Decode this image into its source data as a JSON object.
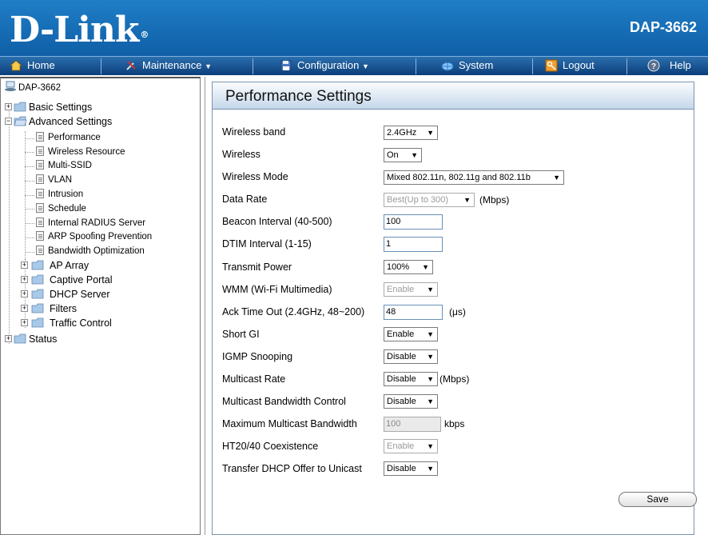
{
  "header": {
    "brand": "D-Link",
    "reg": "®",
    "model": "DAP-3662"
  },
  "menu": {
    "home": "Home",
    "maintenance": "Maintenance",
    "configuration": "Configuration",
    "system": "System",
    "logout": "Logout",
    "help": "Help",
    "dropdown_glyph": "▼"
  },
  "sidebar": {
    "root": "DAP-3662",
    "basic": "Basic Settings",
    "advanced": "Advanced Settings",
    "advanced_items": [
      "Performance",
      "Wireless Resource",
      "Multi-SSID",
      "VLAN",
      "Intrusion",
      "Schedule",
      "Internal RADIUS Server",
      "ARP Spoofing Prevention",
      "Bandwidth Optimization"
    ],
    "folders": [
      "AP Array",
      "Captive Portal",
      "DHCP Server",
      "Filters",
      "Traffic Control"
    ],
    "status": "Status",
    "plus": "+",
    "minus": "−"
  },
  "content": {
    "title": "Performance Settings",
    "rows": [
      {
        "label": "Wireless band",
        "value": "2.4GHz"
      },
      {
        "label": "Wireless",
        "value": "On"
      },
      {
        "label": "Wireless Mode",
        "value": "Mixed 802.11n, 802.11g and 802.11b"
      },
      {
        "label": "Data Rate",
        "value": "Best(Up to 300)",
        "unit": "(Mbps)"
      },
      {
        "label": "Beacon Interval (40-500)",
        "value": "100"
      },
      {
        "label": "DTIM Interval (1-15)",
        "value": "1"
      },
      {
        "label": "Transmit Power",
        "value": "100%"
      },
      {
        "label": "WMM (Wi-Fi Multimedia)",
        "value": "Enable"
      },
      {
        "label": "Ack Time Out  (2.4GHz, 48~200)",
        "value": "48",
        "unit": "(μs)"
      },
      {
        "label": "Short GI",
        "value": "Enable"
      },
      {
        "label": "IGMP Snooping",
        "value": "Disable"
      },
      {
        "label": "Multicast Rate",
        "value": "Disable",
        "unit": "(Mbps)"
      },
      {
        "label": "Multicast Bandwidth Control",
        "value": "Disable"
      },
      {
        "label": "Maximum Multicast Bandwidth",
        "value": "100",
        "unit": "kbps"
      },
      {
        "label": "HT20/40 Coexistence",
        "value": "Enable"
      },
      {
        "label": "Transfer DHCP Offer to Unicast",
        "value": "Disable"
      }
    ],
    "save_label": "Save"
  }
}
